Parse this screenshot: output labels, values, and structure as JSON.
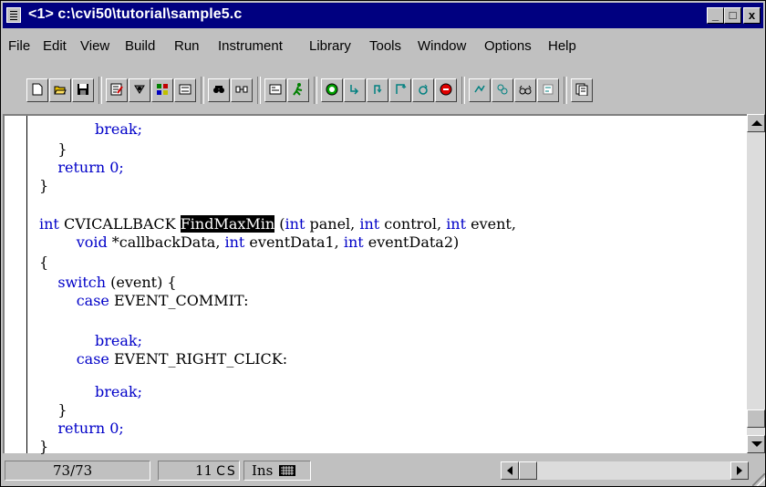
{
  "window": {
    "title": "<1> c:\\cvi50\\tutorial\\sample5.c",
    "minimize_label": "_",
    "maximize_label": "□",
    "close_label": "x"
  },
  "menu": [
    "File",
    "Edit",
    "View",
    "Build",
    "Run",
    "Instrument",
    "Library",
    "Tools",
    "Window",
    "Options",
    "Help"
  ],
  "toolbar": {
    "icons": [
      "new-file-icon",
      "open-file-icon",
      "save-icon",
      "edit-icon",
      "compile-icon",
      "build-icon",
      "panel-icon",
      "find-icon",
      "replace-icon",
      "function-panel-icon",
      "run-icon",
      "go-icon",
      "step-into-icon",
      "step-over-icon",
      "finish-function-icon",
      "continue-icon",
      "stop-icon",
      "breakpoint-icon",
      "watch-icon",
      "glasses-icon",
      "variable-icon",
      "project-icon"
    ]
  },
  "code": {
    "lines": [
      "            break;",
      "    }",
      "    return 0;",
      "}",
      "",
      "int CVICALLBACK FindMaxMin (int panel, int control, int event,",
      "        void *callbackData, int eventData1, int eventData2)",
      "{",
      "    switch (event) {",
      "        case EVENT_COMMIT:",
      "",
      "            break;",
      "        case EVENT_RIGHT_CLICK:",
      "",
      "            break;",
      "    }",
      "    return 0;",
      "}"
    ],
    "highlight": "FindMaxMin"
  },
  "status": {
    "position": "73/73",
    "column": "11",
    "c_flag": "C",
    "s_flag": "S",
    "mode": "Ins"
  }
}
